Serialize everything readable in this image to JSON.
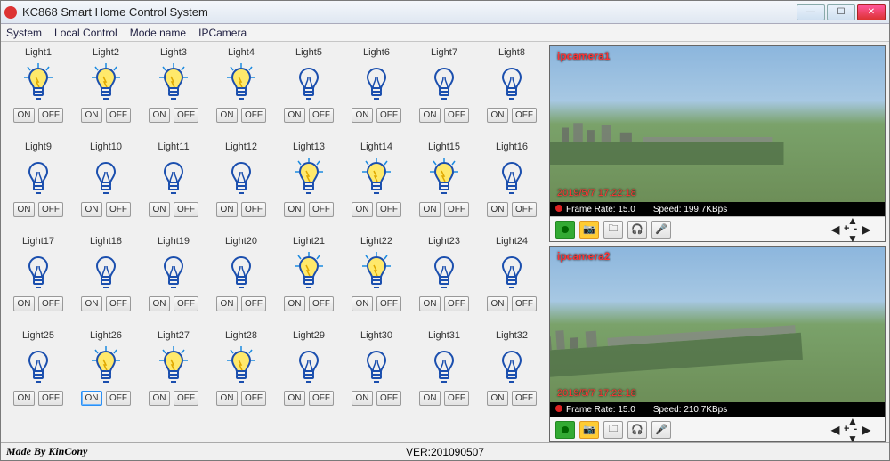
{
  "window": {
    "title": "KC868 Smart Home Control System"
  },
  "menu": [
    "System",
    "Local Control",
    "Mode name",
    "IPCamera"
  ],
  "light": {
    "on_label": "ON",
    "off_label": "OFF",
    "items": [
      {
        "label": "Light1",
        "on": true
      },
      {
        "label": "Light2",
        "on": true
      },
      {
        "label": "Light3",
        "on": true
      },
      {
        "label": "Light4",
        "on": true
      },
      {
        "label": "Light5",
        "on": false
      },
      {
        "label": "Light6",
        "on": false
      },
      {
        "label": "Light7",
        "on": false
      },
      {
        "label": "Light8",
        "on": false
      },
      {
        "label": "Light9",
        "on": false
      },
      {
        "label": "Light10",
        "on": false
      },
      {
        "label": "Light11",
        "on": false
      },
      {
        "label": "Light12",
        "on": false
      },
      {
        "label": "Light13",
        "on": true
      },
      {
        "label": "Light14",
        "on": true
      },
      {
        "label": "Light15",
        "on": true
      },
      {
        "label": "Light16",
        "on": false
      },
      {
        "label": "Light17",
        "on": false
      },
      {
        "label": "Light18",
        "on": false
      },
      {
        "label": "Light19",
        "on": false
      },
      {
        "label": "Light20",
        "on": false
      },
      {
        "label": "Light21",
        "on": true
      },
      {
        "label": "Light22",
        "on": true
      },
      {
        "label": "Light23",
        "on": false
      },
      {
        "label": "Light24",
        "on": false
      },
      {
        "label": "Light25",
        "on": false
      },
      {
        "label": "Light26",
        "on": true
      },
      {
        "label": "Light27",
        "on": true
      },
      {
        "label": "Light28",
        "on": true
      },
      {
        "label": "Light29",
        "on": false
      },
      {
        "label": "Light30",
        "on": false
      },
      {
        "label": "Light31",
        "on": false
      },
      {
        "label": "Light32",
        "on": false
      }
    ],
    "highlight_on_index": 25
  },
  "cams": [
    {
      "label": "ipcamera1",
      "timestamp": "2019/5/7 17:22:18",
      "frame_rate_label": "Frame Rate:",
      "frame_rate": "15.0",
      "speed_label": "Speed:",
      "speed": "199.7KBps"
    },
    {
      "label": "ipcamera2",
      "timestamp": "2019/5/7 17:22:18",
      "frame_rate_label": "Frame Rate:",
      "frame_rate": "15.0",
      "speed_label": "Speed:",
      "speed": "210.7KBps"
    }
  ],
  "footer": {
    "made": "Made By KinCony",
    "ver": "VER:201090507"
  }
}
